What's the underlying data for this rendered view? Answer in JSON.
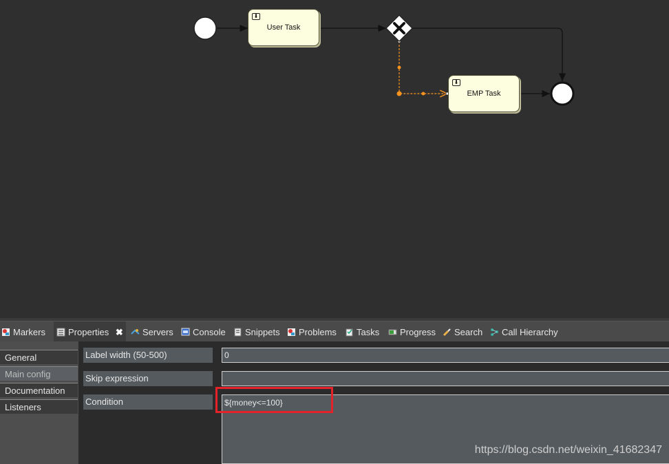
{
  "diagram": {
    "tasks": [
      {
        "label": "User Task"
      },
      {
        "label": "EMP Task"
      }
    ]
  },
  "tabs": [
    {
      "label": "Markers"
    },
    {
      "label": "Properties"
    },
    {
      "label": "Servers"
    },
    {
      "label": "Console"
    },
    {
      "label": "Snippets"
    },
    {
      "label": "Problems"
    },
    {
      "label": "Tasks"
    },
    {
      "label": "Progress"
    },
    {
      "label": "Search"
    },
    {
      "label": "Call Hierarchy"
    }
  ],
  "nav": [
    {
      "label": "General"
    },
    {
      "label": "Main config"
    },
    {
      "label": "Documentation"
    },
    {
      "label": "Listeners"
    }
  ],
  "properties": [
    {
      "label": "Label width (50-500)",
      "value": "0"
    },
    {
      "label": "Skip expression",
      "value": ""
    },
    {
      "label": "Condition",
      "value": "${money<=100}"
    }
  ],
  "watermark": "https://blog.csdn.net/weixin_41682347",
  "colors": {
    "accent": "#e5222a",
    "flow_selected": "#f7931e"
  }
}
